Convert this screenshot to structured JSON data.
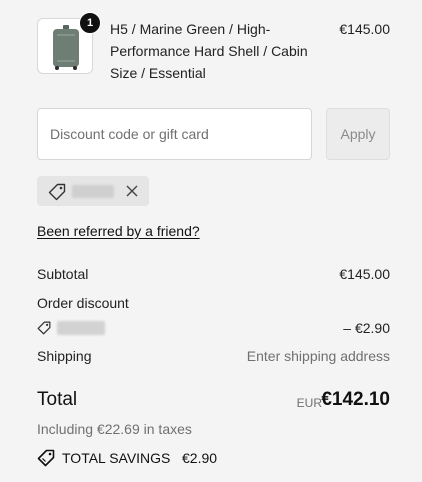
{
  "item": {
    "quantity": "1",
    "title": "H5 / Marine Green / High-Performance Hard Shell / Cabin Size / Essential",
    "price": "€145.00",
    "thumbnail_icon": "suitcase-icon",
    "color": "#6f7e74"
  },
  "discount": {
    "placeholder": "Discount code or gift card",
    "value": "",
    "apply_label": "Apply"
  },
  "applied_code": {
    "icon": "tag-icon",
    "remove_icon": "close-icon"
  },
  "referral_link": "Been referred by a friend?",
  "summary": {
    "subtotal_label": "Subtotal",
    "subtotal_value": "€145.00",
    "order_discount_label": "Order discount",
    "discount_value": "– €2.90",
    "shipping_label": "Shipping",
    "shipping_value": "Enter shipping address"
  },
  "total": {
    "label": "Total",
    "currency": "EUR",
    "value": "€142.10",
    "taxes": "Including €22.69 in taxes"
  },
  "savings": {
    "label": "TOTAL SAVINGS",
    "value": "€2.90",
    "icon": "savings-tag-icon"
  }
}
